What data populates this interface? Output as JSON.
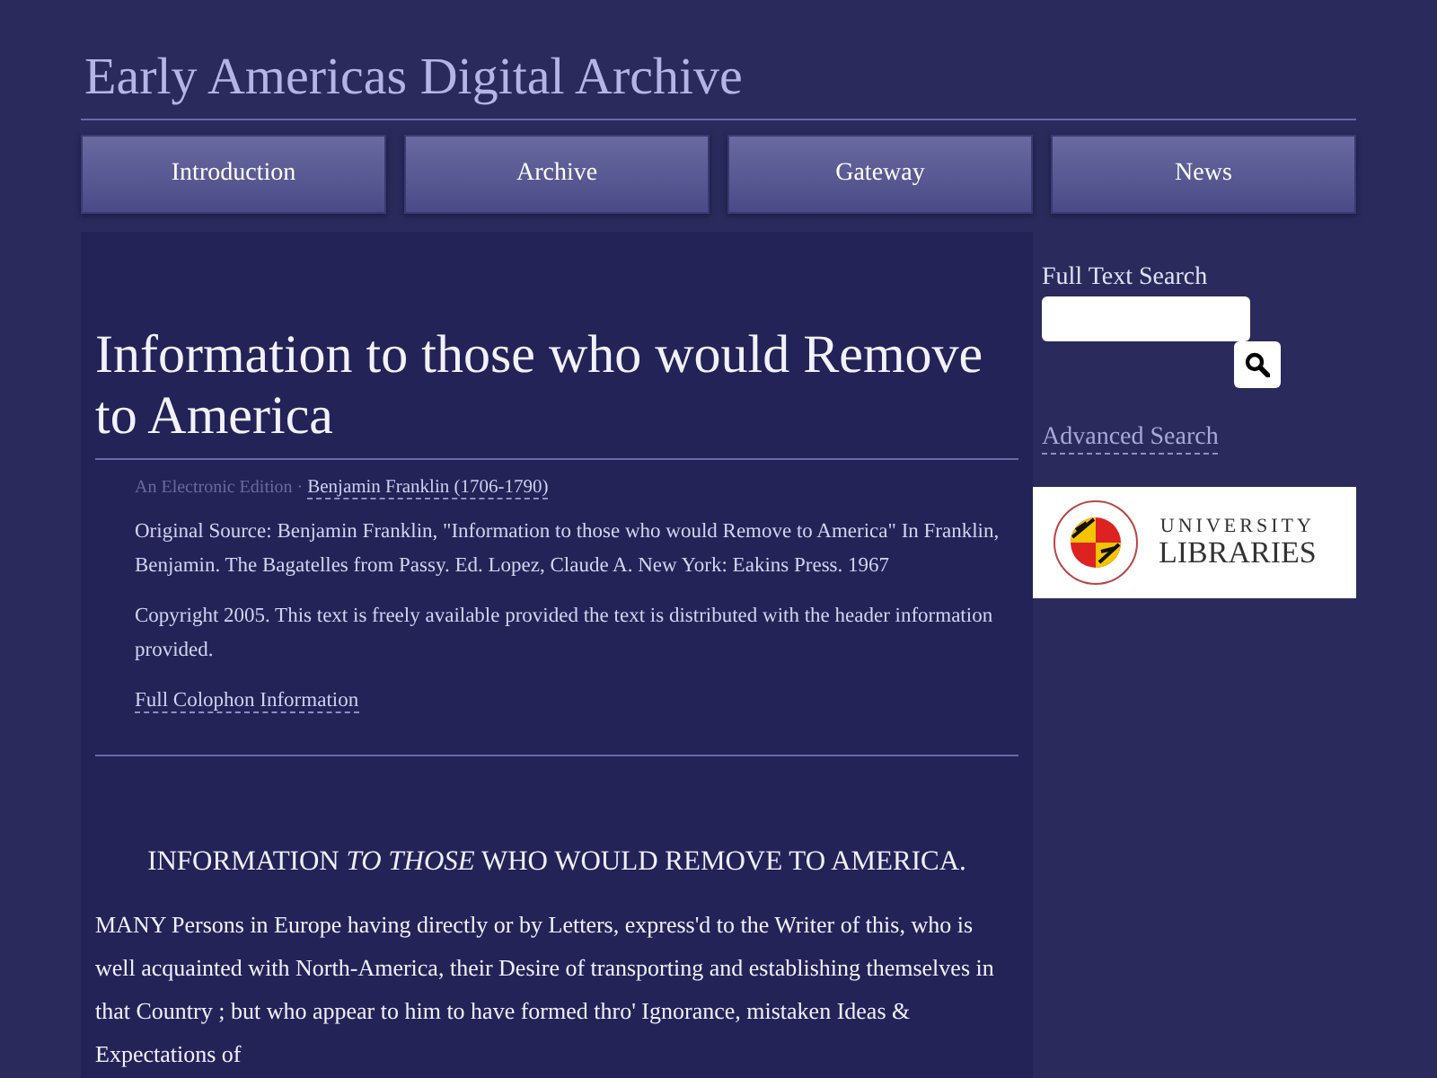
{
  "site_title": "Early Americas Digital Archive",
  "nav": [
    {
      "label": "Introduction"
    },
    {
      "label": "Archive"
    },
    {
      "label": "Gateway"
    },
    {
      "label": "News"
    }
  ],
  "document": {
    "title": "Information to those who would Remove to America",
    "edition": "An Electronic Edition",
    "separator": "·",
    "author_link": "Benjamin Franklin (1706-1790)",
    "source": "Original Source: Benjamin Franklin, \"Information to those who would Remove to America\" In Franklin, Benjamin. The Bagatelles from Passy. Ed. Lopez, Claude A. New York: Eakins Press. 1967",
    "copyright": "Copyright 2005. This text is freely available provided the text is distributed with the header information provided.",
    "colophon_link": "Full Colophon Information",
    "section_heading": "INFORMATION *TO THOSE* WHO WOULD REMOVE TO AMERICA.",
    "body": "MANY Persons in Europe having directly or by Letters, express'd to the Writer of this, who is well acquainted with North-America, their Desire of transporting and establishing themselves in that Country ; but who appear to him to have formed thro' Ignorance, mistaken Ideas & Expectations of"
  },
  "sidebar": {
    "search_label": "Full Text Search",
    "advanced_link": "Advanced Search",
    "logo": {
      "line_1": "UNIVERSITY",
      "line_2": "LIBRARIES"
    }
  }
}
